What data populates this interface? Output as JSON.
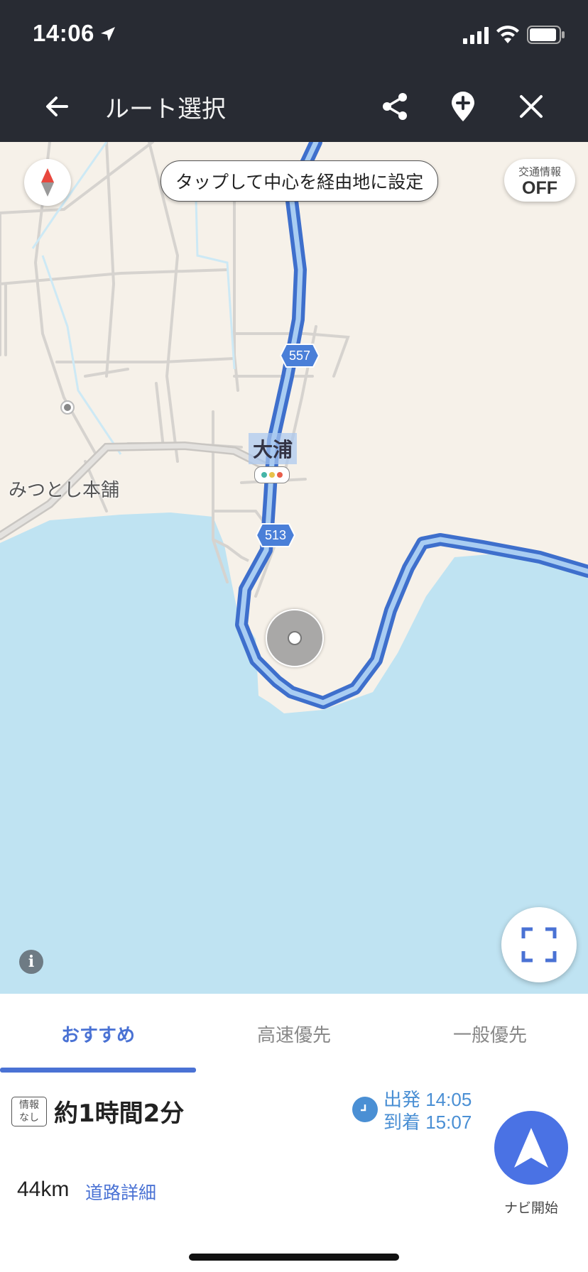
{
  "status_bar": {
    "time": "14:06"
  },
  "header": {
    "title": "ルート選択",
    "back_icon": "back-arrow-icon",
    "share_icon": "share-icon",
    "add_waypoint_icon": "pin-plus-icon",
    "close_icon": "close-icon"
  },
  "map": {
    "hint": "タップして中心を経由地に設定",
    "traffic": {
      "label": "交通情報",
      "value": "OFF"
    },
    "place_label": "みつとし本舗",
    "town_label": "大浦",
    "road_557": "557",
    "road_513": "513",
    "info_button": "i",
    "colors": {
      "land": "#f6f1e9",
      "water": "#bfe3f2",
      "route": "#4a7fd8",
      "route_inner": "#9fc6ef"
    }
  },
  "tabs": [
    {
      "label": "おすすめ",
      "active": true
    },
    {
      "label": "高速優先",
      "active": false
    },
    {
      "label": "一般優先",
      "active": false
    }
  ],
  "summary": {
    "badge": [
      "情報",
      "なし"
    ],
    "duration": "約1時間2分",
    "departure": "出発 14:05",
    "arrival": "到着 15:07",
    "distance": "44km",
    "detail_link": "道路詳細",
    "navi_label": "ナビ開始"
  }
}
